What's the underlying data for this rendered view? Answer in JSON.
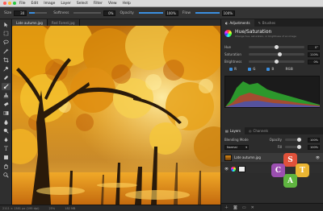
{
  "menubar": {
    "items": [
      "File",
      "Edit",
      "Image",
      "Layer",
      "Select",
      "Filter",
      "View",
      "Help"
    ],
    "colors": {
      "close": "#ff5f57",
      "minimize": "#febc2e",
      "zoom": "#28c840"
    }
  },
  "options": {
    "size_label": "Size",
    "size_value": "30",
    "softness_label": "Softness",
    "softness_value": "0%",
    "opacity_label": "Opacity",
    "opacity_value": "100%",
    "flow_label": "Flow",
    "flow_value": "100%"
  },
  "document_tabs": [
    {
      "label": "Late autumn.jpg",
      "active": true
    },
    {
      "label": "Red Forest.jpg",
      "active": false
    }
  ],
  "status": {
    "size": "2111 × 1381 px (195 dpi)",
    "zoom": "25%",
    "memory": "182 MB"
  },
  "panel": {
    "tabs": [
      {
        "label": "Adjustments",
        "active": true
      },
      {
        "label": "Brushes",
        "active": false
      }
    ],
    "title": "Hue/Saturation",
    "description": "Change hue, saturation, or brightness of an image",
    "sliders": [
      {
        "label": "Hue",
        "value": "0°",
        "level": 0.5
      },
      {
        "label": "Saturation",
        "value": "110%",
        "level": 0.55
      },
      {
        "label": "Brightness",
        "value": "0%",
        "level": 0.5
      }
    ],
    "channels": [
      "R",
      "G",
      "B",
      "RGB"
    ],
    "accent": "#3b8fe0"
  },
  "layers": {
    "tabs": [
      {
        "label": "Layers",
        "active": true
      },
      {
        "label": "Channels",
        "active": false
      }
    ],
    "blending_label": "Blending Mode",
    "blending_value": "Normal",
    "opacity_label": "Opacity",
    "opacity_value": "100%",
    "fill_label": "Fill",
    "fill_value": "100%",
    "items": [
      {
        "name": "Late autumn.jpg"
      }
    ]
  },
  "tools": [
    "move-icon",
    "marquee-icon",
    "lasso-icon",
    "wand-icon",
    "crop-icon",
    "eyedropper-icon",
    "heal-icon",
    "brush-icon",
    "stamp-icon",
    "eraser-icon",
    "gradient-icon",
    "blur-icon",
    "dodge-icon",
    "pen-icon",
    "text-icon",
    "shape-icon",
    "hand-icon",
    "zoom-icon"
  ]
}
